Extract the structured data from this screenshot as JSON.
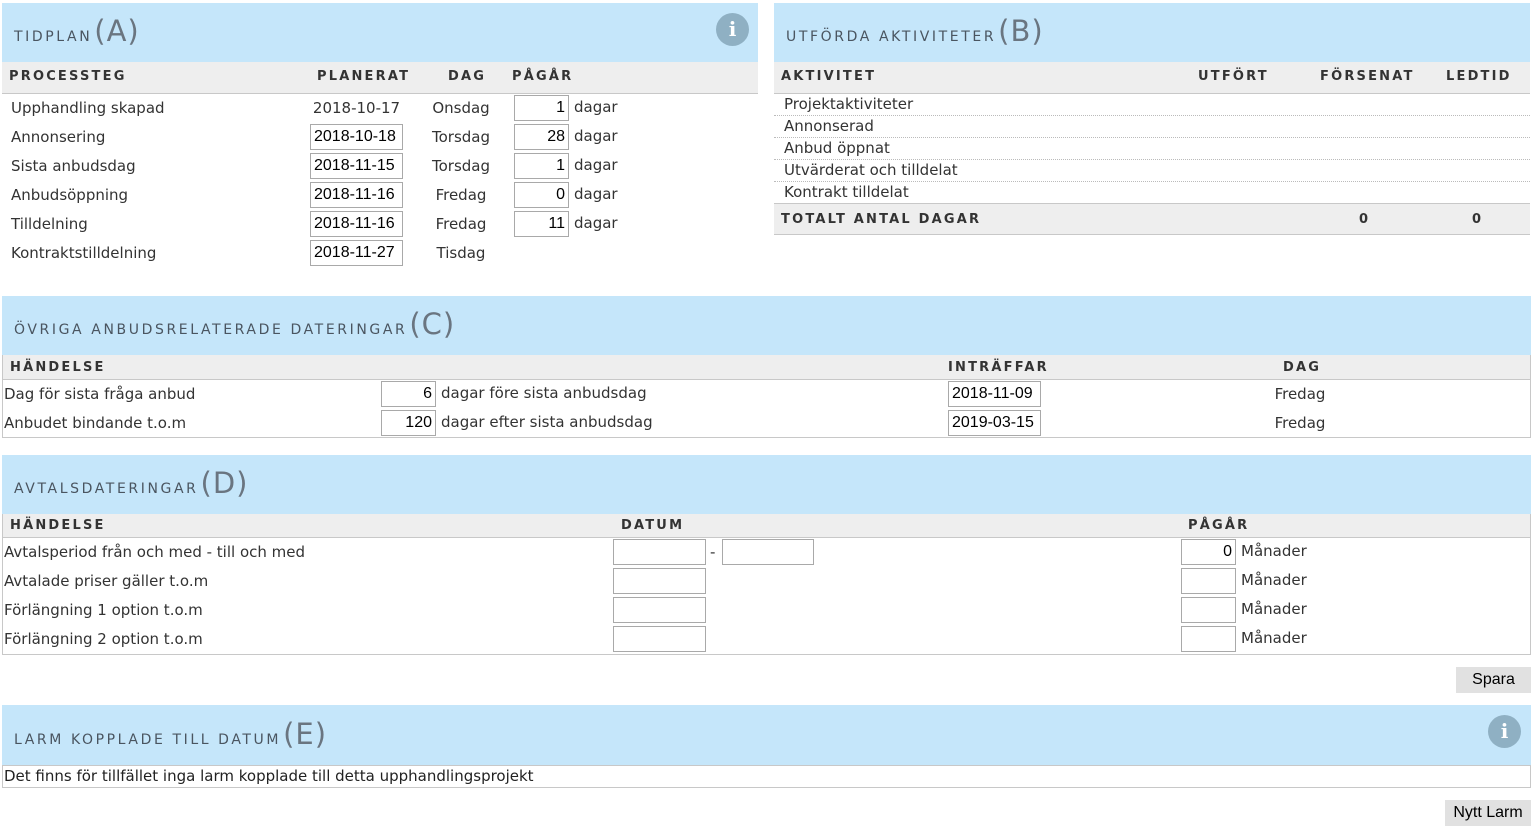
{
  "tidplan": {
    "title": "TIDPLAN",
    "letter": "(A)",
    "info_icon": "info-icon",
    "col_processsteg": "PROCESSTEG",
    "col_planerat": "PLANERAT",
    "col_dag": "DAG",
    "col_pagar": "PÅGÅR",
    "unit": "dagar",
    "rows": [
      {
        "step": "Upphandling skapad",
        "date": "2018-10-17",
        "day": "Onsdag",
        "duration": "1"
      },
      {
        "step": "Annonsering",
        "date": "2018-10-18",
        "day": "Torsdag",
        "duration": "28"
      },
      {
        "step": "Sista anbudsdag",
        "date": "2018-11-15",
        "day": "Torsdag",
        "duration": "1"
      },
      {
        "step": "Anbudsöppning",
        "date": "2018-11-16",
        "day": "Fredag",
        "duration": "0"
      },
      {
        "step": "Tilldelning",
        "date": "2018-11-16",
        "day": "Fredag",
        "duration": "11"
      },
      {
        "step": "Kontraktstilldelning",
        "date": "2018-11-27",
        "day": "Tisdag",
        "duration": ""
      }
    ]
  },
  "utforda": {
    "title": "UTFÖRDA AKTIVITETER",
    "letter": "(B)",
    "col_aktivitet": "AKTIVITET",
    "col_utfort": "UTFÖRT",
    "col_forsenat": "FÖRSENAT",
    "col_ledtid": "LEDTID",
    "rows": [
      "Projektaktiviteter",
      "Annonserad",
      "Anbud öppnat",
      "Utvärderat och tilldelat",
      "Kontrakt tilldelat"
    ],
    "total_label": "TOTALT ANTAL DAGAR",
    "total_forsenat": "0",
    "total_ledtid": "0"
  },
  "ovriga": {
    "title": "ÖVRIGA ANBUDSRELATERADE DATERINGAR",
    "letter": "(C)",
    "col_handelse": "HÄNDELSE",
    "col_intraffar": "INTRÄFFAR",
    "col_dag": "DAG",
    "rows": [
      {
        "event": "Dag för sista fråga anbud",
        "days": "6",
        "relation": "dagar före sista anbudsdag",
        "date": "2018-11-09",
        "day": "Fredag"
      },
      {
        "event": "Anbudet bindande t.o.m",
        "days": "120",
        "relation": "dagar efter sista anbudsdag",
        "date": "2019-03-15",
        "day": "Fredag"
      }
    ]
  },
  "avtal": {
    "title": "AVTALSDATERINGAR",
    "letter": "(D)",
    "col_handelse": "HÄNDELSE",
    "col_datum": "DATUM",
    "col_pagar": "PÅGÅR",
    "separator": "-",
    "unit": "Månader",
    "rows": [
      {
        "event": "Avtalsperiod från och med - till och med",
        "months": "0"
      },
      {
        "event": "Avtalade priser gäller t.o.m",
        "months": ""
      },
      {
        "event": "Förlängning 1 option t.o.m",
        "months": ""
      },
      {
        "event": "Förlängning 2 option t.o.m",
        "months": ""
      }
    ],
    "save_button": "Spara"
  },
  "larm": {
    "title": "LARM KOPPLADE TILL DATUM",
    "letter": "(E)",
    "info_icon": "info-icon",
    "empty_text": "Det finns för tillfället inga larm kopplade till detta upphandlingsprojekt",
    "new_button": "Nytt Larm"
  }
}
